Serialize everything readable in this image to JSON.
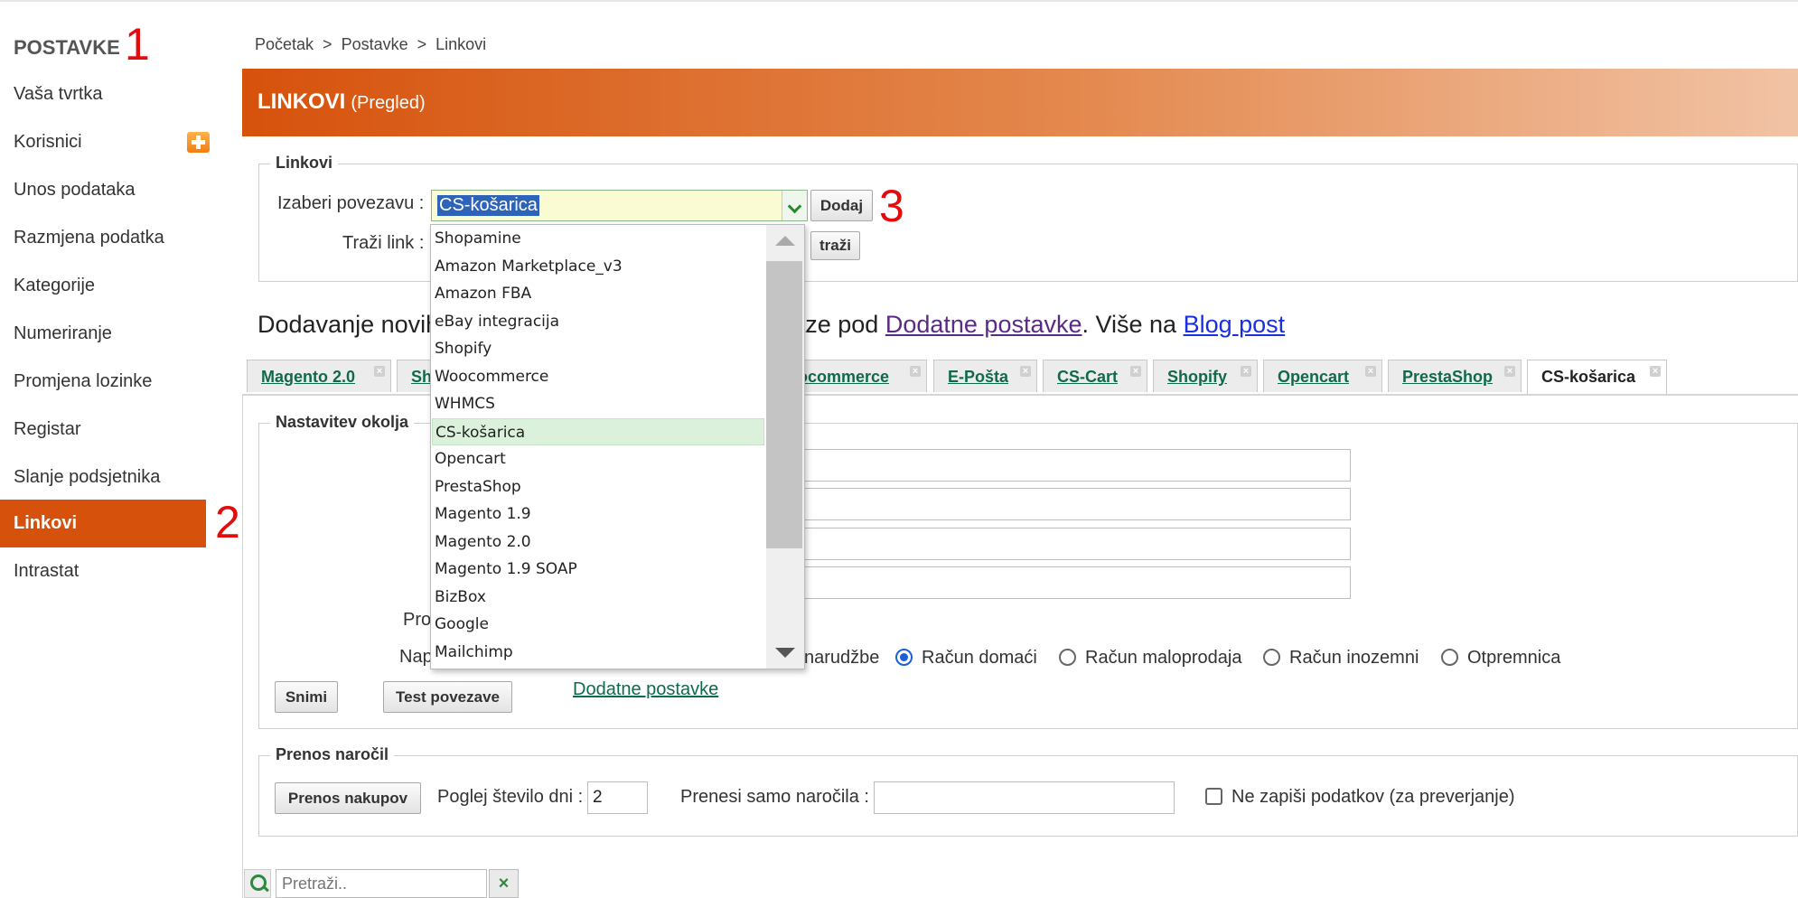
{
  "sidebar": {
    "title": "POSTAVKE",
    "items": [
      {
        "label": "Vaša tvrtka"
      },
      {
        "label": "Korisnici"
      },
      {
        "label": "Unos podataka"
      },
      {
        "label": "Razmjena podatka"
      },
      {
        "label": "Kategorije"
      },
      {
        "label": "Numeriranje"
      },
      {
        "label": "Promjena lozinke"
      },
      {
        "label": "Registar"
      },
      {
        "label": "Slanje podsjetnika"
      },
      {
        "label": "Linkovi"
      },
      {
        "label": "Intrastat"
      }
    ],
    "active": "Linkovi"
  },
  "annotations": {
    "one": "1",
    "two": "2",
    "three": "3"
  },
  "breadcrumb": [
    "Početak",
    ">",
    "Postavke",
    ">",
    "Linkovi"
  ],
  "header": {
    "title": "LINKOVI",
    "subtitle": "(Pregled)"
  },
  "links_section": {
    "legend": "Linkovi",
    "choose_label": "Izaberi povezavu :",
    "selected_value": "CS-košarica",
    "add_button": "Dodaj",
    "search_label": "Traži link :",
    "search_button": "traži"
  },
  "info": {
    "text_before": "Dodavanje novih",
    "text_middle": "a istih se nalaze pod",
    "link1": "Dodatne postavke",
    "text_after": ". Više na",
    "link2": "Blog post"
  },
  "tabs": [
    {
      "label": "Magento 2.0"
    },
    {
      "label": "Sh"
    },
    {
      "label": "ocommerce"
    },
    {
      "label": "E-Pošta"
    },
    {
      "label": "CS-Cart"
    },
    {
      "label": "Shopify"
    },
    {
      "label": "Opencart"
    },
    {
      "label": "PrestaShop"
    },
    {
      "label": "CS-košarica",
      "active": true
    }
  ],
  "settings": {
    "legend": "Nastavitev okolja",
    "label_pro": "Pro",
    "label_nap": "Nap",
    "radio_partial": "narudžbe",
    "radios": [
      {
        "label": "Račun domaći",
        "checked": true
      },
      {
        "label": "Račun maloprodaja",
        "checked": false
      },
      {
        "label": "Račun inozemni",
        "checked": false
      },
      {
        "label": "Otpremnica",
        "checked": false
      }
    ],
    "save_button": "Snimi",
    "test_button": "Test povezave",
    "extra_link": "Dodatne postavke"
  },
  "transfer": {
    "legend": "Prenos naročil",
    "transfer_button": "Prenos nakupov",
    "days_label": "Poglej število dni :",
    "days_value": "2",
    "only_orders_label": "Prenesi samo naročila :",
    "only_orders_value": "",
    "no_write_label": "Ne zapiši podatkov (za preverjanje)"
  },
  "dropdown": {
    "options": [
      "Shopamine",
      "Amazon Marketplace_v3",
      "Amazon FBA",
      "eBay integracija",
      "Shopify",
      "Woocommerce",
      "WHMCS",
      "CS-košarica",
      "Opencart",
      "PrestaShop",
      "Magento 1.9",
      "Magento 2.0",
      "Magento 1.9 SOAP",
      "BizBox",
      "Google",
      "Mailchimp"
    ],
    "selected": "CS-košarica"
  },
  "bottom_search": {
    "placeholder": "Pretraži..",
    "clear": "×"
  }
}
